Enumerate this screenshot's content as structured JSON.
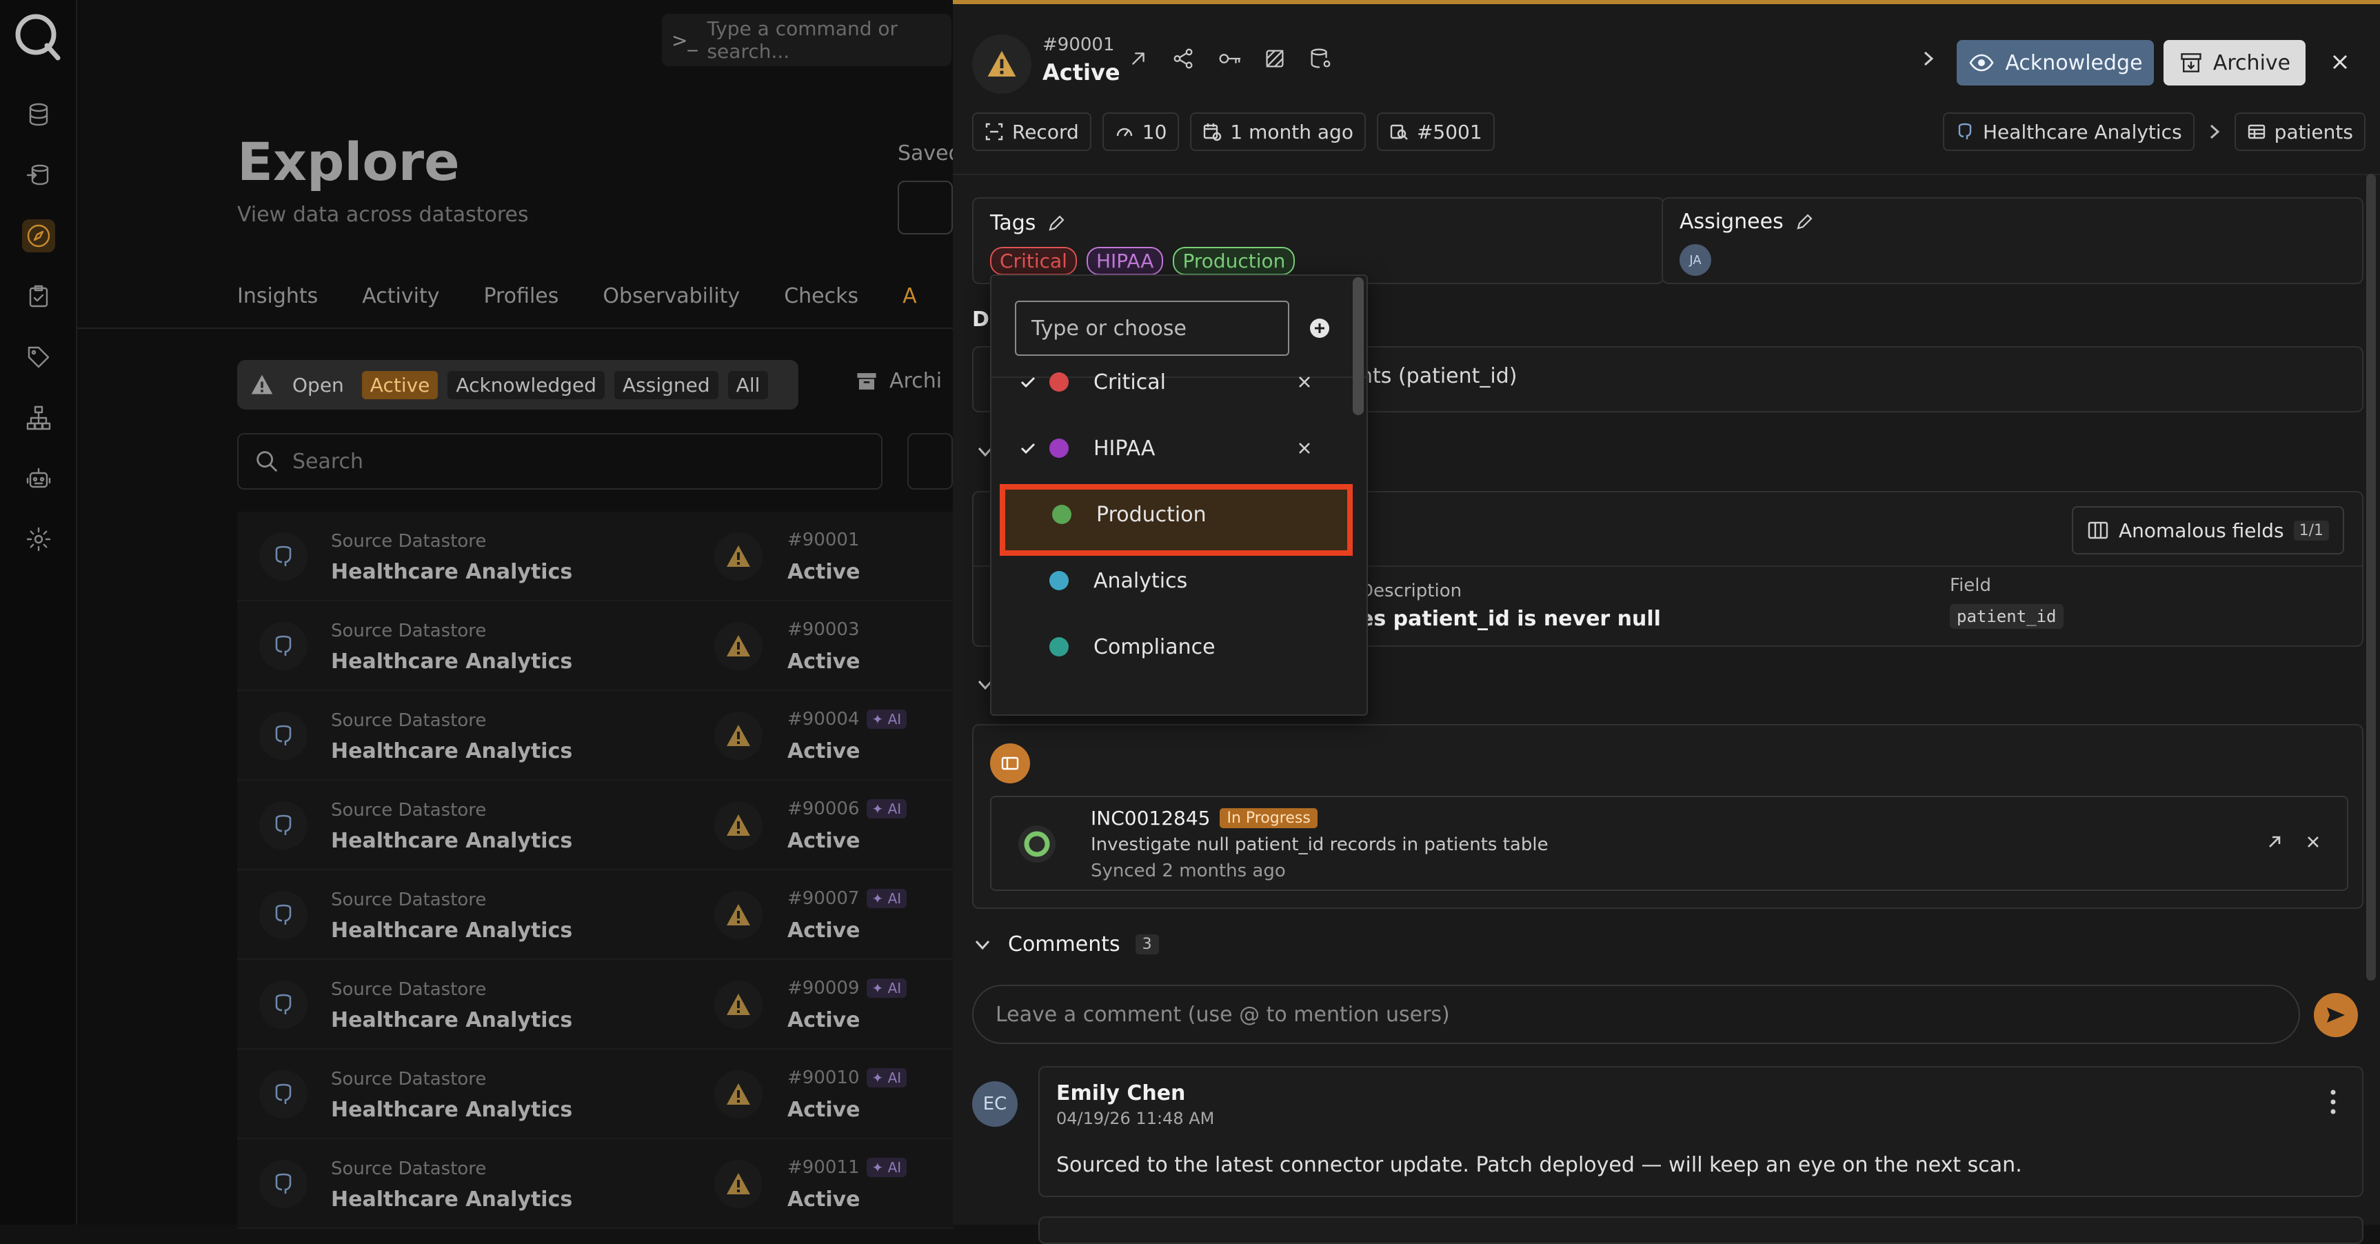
{
  "command": {
    "placeholder": "Type a command or search..."
  },
  "explore": {
    "title": "Explore",
    "subtitle": "View data across datastores",
    "saved_label": "Saved",
    "tabs": [
      "Insights",
      "Activity",
      "Profiles",
      "Observability",
      "Checks",
      "A"
    ],
    "status_filters": {
      "open": "Open",
      "active": "Active",
      "acknowledged": "Acknowledged",
      "assigned": "Assigned",
      "all": "All"
    },
    "archive_label": "Archi",
    "search_placeholder": "Search",
    "rows": [
      {
        "label": "Source Datastore",
        "name": "Healthcare Analytics",
        "num": "#90001",
        "ai": "",
        "status": "Active"
      },
      {
        "label": "Source Datastore",
        "name": "Healthcare Analytics",
        "num": "#90003",
        "ai": "",
        "status": "Active"
      },
      {
        "label": "Source Datastore",
        "name": "Healthcare Analytics",
        "num": "#90004",
        "ai": "✦ AI",
        "status": "Active"
      },
      {
        "label": "Source Datastore",
        "name": "Healthcare Analytics",
        "num": "#90006",
        "ai": "✦ AI",
        "status": "Active"
      },
      {
        "label": "Source Datastore",
        "name": "Healthcare Analytics",
        "num": "#90007",
        "ai": "✦ AI",
        "status": "Active"
      },
      {
        "label": "Source Datastore",
        "name": "Healthcare Analytics",
        "num": "#90009",
        "ai": "✦ AI",
        "status": "Active"
      },
      {
        "label": "Source Datastore",
        "name": "Healthcare Analytics",
        "num": "#90010",
        "ai": "✦ AI",
        "status": "Active"
      },
      {
        "label": "Source Datastore",
        "name": "Healthcare Analytics",
        "num": "#90011",
        "ai": "✦ AI",
        "status": "Active"
      }
    ]
  },
  "panel": {
    "number": "#90001",
    "status": "Active",
    "acknowledge": "Acknowledge",
    "archive": "Archive",
    "pills": {
      "type": "Record",
      "score": "10",
      "age": "1 month ago",
      "check": "#5001"
    },
    "breadcrumb": {
      "datastore": "Healthcare Analytics",
      "table": "patients"
    },
    "tags_label": "Tags",
    "tags": [
      {
        "name": "Critical",
        "color": "#e05252",
        "bg": "#3a1c1c"
      },
      {
        "name": "HIPAA",
        "color": "#c17ad8",
        "bg": "#2f1e3a"
      },
      {
        "name": "Production",
        "color": "#7ccf7a",
        "bg": "#1f3320"
      }
    ],
    "assignees_label": "Assignees",
    "assignee_initials": "JA",
    "desc_label": "De",
    "desc_text": "nts (patient_id)",
    "anomalous_fields_button": "Anomalous fields",
    "anomalous_fields_count": "1/1",
    "desc_col_label": "Description",
    "desc_col_value": "es patient_id is never null",
    "field_label": "Field",
    "field_value": "patient_id",
    "ticket": {
      "id": "INC0012845",
      "state": "In Progress",
      "description": "Investigate null patient_id records in patients table",
      "synced": "Synced 2 months ago"
    },
    "comments_label": "Comments",
    "comments_count": "3",
    "comment_placeholder": "Leave a comment (use @ to mention users)",
    "comment": {
      "initials": "EC",
      "author": "Emily Chen",
      "date": "04/19/26 11:48 AM",
      "text": "Sourced to the latest connector update. Patch deployed — will keep an eye on the next scan."
    }
  },
  "dropdown": {
    "placeholder": "Type or choose",
    "options": [
      {
        "label": "Critical",
        "color": "#d94848",
        "checked": true
      },
      {
        "label": "HIPAA",
        "color": "#9a3bc0",
        "checked": true
      },
      {
        "label": "Production",
        "color": "#5aa654",
        "checked": false,
        "highlighted": true
      },
      {
        "label": "Analytics",
        "color": "#3fa6c6",
        "checked": false
      },
      {
        "label": "Compliance",
        "color": "#2f9e8e",
        "checked": false
      }
    ]
  },
  "colors": {
    "accent": "#c98a2e",
    "acknowledge_bg": "#4f6885",
    "highlight_border": "#e8401f"
  }
}
